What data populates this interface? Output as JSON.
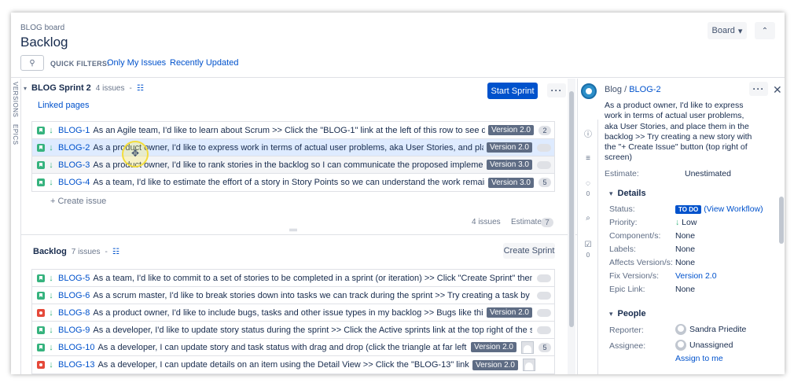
{
  "header": {
    "breadcrumb": "BLOG board",
    "title": "Backlog",
    "board_button": "Board",
    "quick_filters_label": "QUICK FILTERS:",
    "quick_filters": [
      "Only My Issues",
      "Recently Updated"
    ]
  },
  "side_tabs": [
    "VERSIONS",
    "EPICS"
  ],
  "sprint": {
    "name": "BLOG Sprint 2",
    "count": "4 issues",
    "linked_pages": "Linked pages",
    "start_button": "Start Sprint",
    "create_issue": "+  Create issue",
    "footer_count": "4 issues",
    "footer_estimate": "Estimate",
    "footer_estimate_value": "7",
    "issues": [
      {
        "type": "story",
        "key": "BLOG-1",
        "summary": "As an Agile team, I'd like to learn about Scrum >> Click the \"BLOG-1\" link at the left of this row to see detail in the Description",
        "version": "Version 2.0",
        "points": "2",
        "state": ""
      },
      {
        "type": "story",
        "key": "BLOG-2",
        "summary": "As a product owner, I'd like to express work in terms of actual user problems, aka User Stories, and place them in the backlog",
        "version": "Version 2.0",
        "points": "",
        "state": "sel"
      },
      {
        "type": "story",
        "key": "BLOG-3",
        "summary": "As a product owner, I'd like to rank stories in the backlog so I can communicate the proposed implementation order >> Try d",
        "version": "Version 3.0",
        "points": "",
        "state": "sel2"
      },
      {
        "type": "story",
        "key": "BLOG-4",
        "summary": "As a team, I'd like to estimate the effort of a story in Story Points so we can understand the work remaining >> Try setting the",
        "version": "Version 3.0",
        "points": "5",
        "state": ""
      }
    ]
  },
  "backlog": {
    "name": "Backlog",
    "count": "7 issues",
    "create_sprint": "Create Sprint",
    "issues": [
      {
        "type": "story",
        "key": "BLOG-5",
        "summary": "As a team, I'd like to commit to a set of stories to be completed in a sprint (or iteration) >> Click \"Create Sprint\" then drag the footer down",
        "version": "",
        "points": "",
        "avatar": false
      },
      {
        "type": "story",
        "key": "BLOG-6",
        "summary": "As a scrum master, I'd like to break stories down into tasks we can track during the sprint >> Try creating a task by clicking the Sub-Tasks ta",
        "version": "",
        "points": "",
        "avatar": false
      },
      {
        "type": "bug",
        "key": "BLOG-8",
        "summary": "As a product owner, I'd like to include bugs, tasks and other issue types in my backlog >> Bugs like this one will also appear i",
        "version": "Version 2.0",
        "points": "",
        "avatar": false
      },
      {
        "type": "story",
        "key": "BLOG-9",
        "summary": "As a developer, I'd like to update story status during the sprint >> Click the Active sprints link at the top right of the screen to go to the Acti",
        "version": "",
        "points": "",
        "avatar": false
      },
      {
        "type": "story",
        "key": "BLOG-10",
        "summary": "As a developer, I can update story and task status with drag and drop (click the triangle at far left of this story to show s",
        "version": "Version 2.0",
        "points": "5",
        "avatar": true
      },
      {
        "type": "bug",
        "key": "BLOG-13",
        "summary": "As a developer, I can update details on an item using the Detail View >> Click the \"BLOG-13\" link at the top of this card",
        "version": "Version 2.0",
        "points": "",
        "avatar": true
      }
    ]
  },
  "detail": {
    "project": "Blog",
    "key": "BLOG-2",
    "description": "As a product owner, I'd like to express work in terms of actual user problems, aka User Stories, and place them in the backlog >> Try creating a new story with the \"+ Create Issue\" button (top right of screen)",
    "estimate_label": "Estimate:",
    "estimate_value": "Unestimated",
    "details_title": "Details",
    "status_label": "Status:",
    "status_value": "TO DO",
    "view_workflow": "(View Workflow)",
    "priority_label": "Priority:",
    "priority_value": "Low",
    "components_label": "Component/s:",
    "components_value": "None",
    "labels_label": "Labels:",
    "labels_value": "None",
    "affects_label": "Affects Version/s:",
    "affects_value": "None",
    "fix_label": "Fix Version/s:",
    "fix_value": "Version 2.0",
    "epic_label": "Epic Link:",
    "epic_value": "None",
    "people_title": "People",
    "reporter_label": "Reporter:",
    "reporter_value": "Sandra Priedite",
    "assignee_label": "Assignee:",
    "assignee_value": "Unassigned",
    "assign_to_me": "Assign to me",
    "comment_count": "0",
    "subtask_count": "0"
  }
}
